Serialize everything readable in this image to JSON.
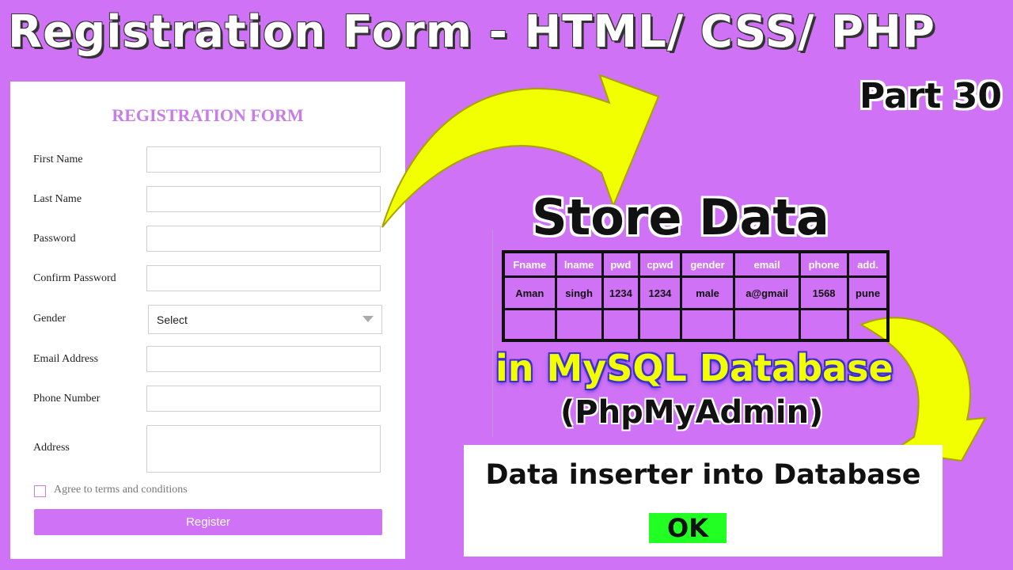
{
  "header": {
    "title": "Registration Form - HTML/ CSS/ PHP",
    "part": "Part 30"
  },
  "form": {
    "title": "REGISTRATION FORM",
    "fields": [
      {
        "label": "First Name",
        "value": ""
      },
      {
        "label": "Last Name",
        "value": ""
      },
      {
        "label": "Password",
        "value": ""
      },
      {
        "label": "Confirm Password",
        "value": ""
      },
      {
        "label": "Gender",
        "selected": "Select"
      },
      {
        "label": "Email Address",
        "value": ""
      },
      {
        "label": "Phone Number",
        "value": ""
      },
      {
        "label": "Address",
        "value": ""
      }
    ],
    "agree_label": "Agree to terms and conditions",
    "agree_checked": false,
    "register_label": "Register",
    "accent_color": "#c77de8"
  },
  "store": {
    "title": "Store Data",
    "columns": [
      "Fname",
      "lname",
      "pwd",
      "cpwd",
      "gender",
      "email",
      "phone",
      "add."
    ],
    "rows": [
      [
        "Aman",
        "singh",
        "1234",
        "1234",
        "male",
        "a@gmail",
        "1568",
        "pune"
      ],
      [
        "",
        "",
        "",
        "",
        "",
        "",
        "",
        ""
      ]
    ],
    "subtitle": "in MySQL Database",
    "subtitle2": "(PhpMyAdmin)"
  },
  "alert": {
    "message": "Data inserter into Database",
    "ok_label": "OK"
  },
  "colors": {
    "background": "#cf72f5",
    "arrow": "#f1ff00",
    "ok_button": "#22ff22"
  }
}
